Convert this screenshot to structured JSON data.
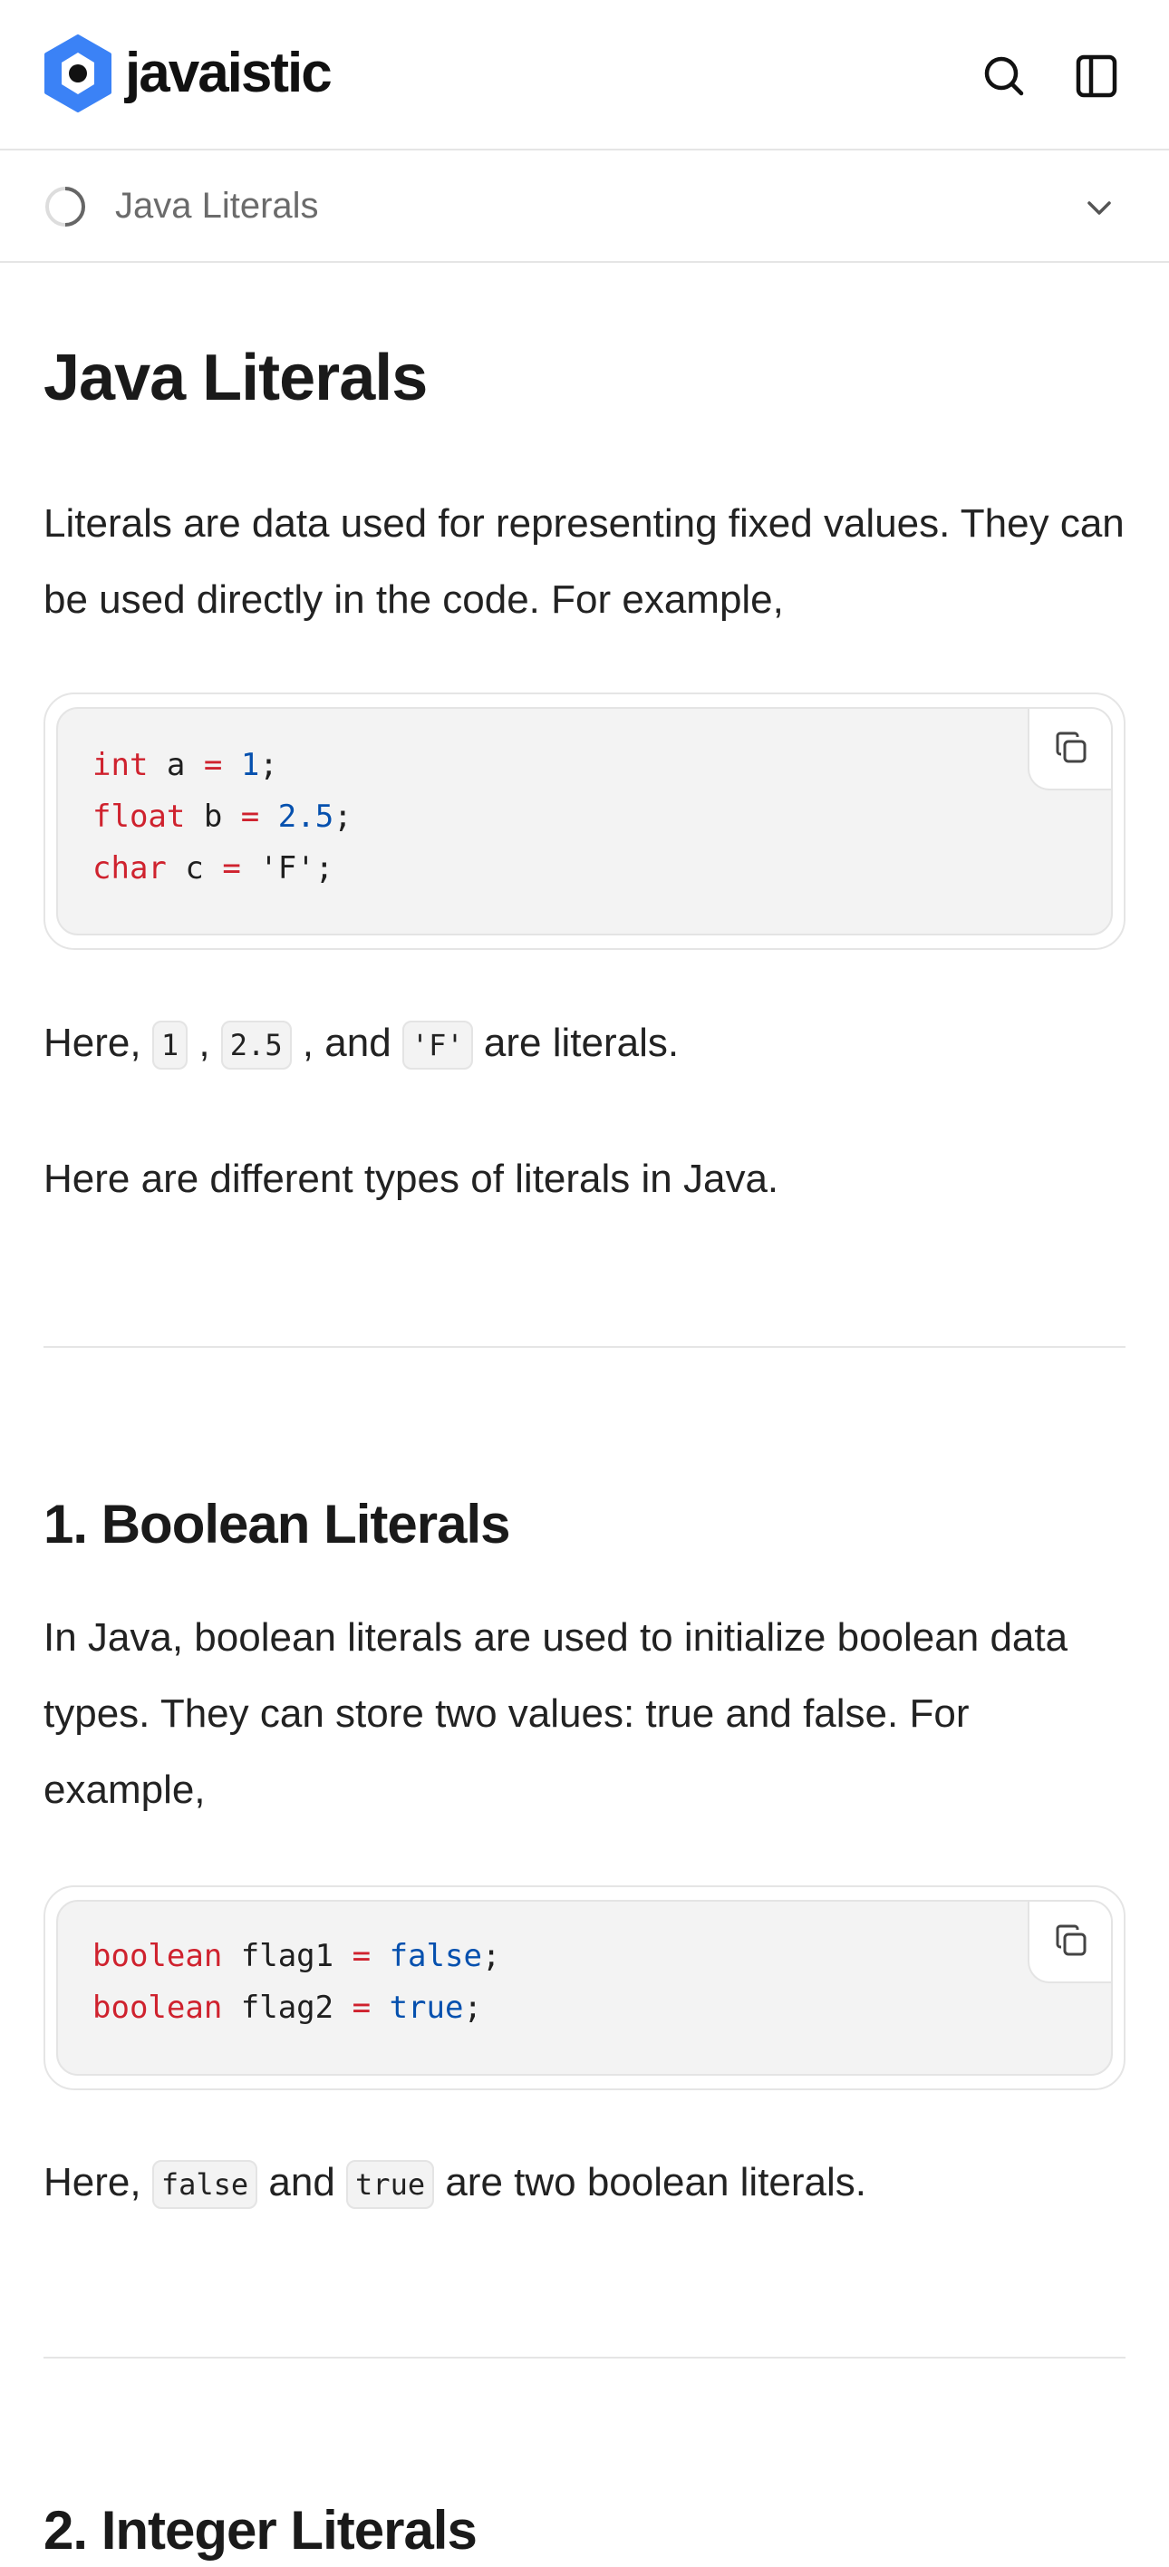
{
  "header": {
    "brand": "javaistic",
    "brand_color": "#3b82f6",
    "icons": [
      "search-icon",
      "sidebar-toggle-icon"
    ]
  },
  "breadcrumb": {
    "label": "Java Literals"
  },
  "article": {
    "title": "Java Literals",
    "intro": "Literals are data used for representing fixed values. They can be used directly in the code. For example,",
    "code1": [
      [
        {
          "t": "int",
          "c": "kw"
        },
        {
          "t": " a "
        },
        {
          "t": "=",
          "c": "kw"
        },
        {
          "t": " "
        },
        {
          "t": "1",
          "c": "num"
        },
        {
          "t": ";"
        }
      ],
      [
        {
          "t": "float",
          "c": "kw"
        },
        {
          "t": " b "
        },
        {
          "t": "=",
          "c": "kw"
        },
        {
          "t": " "
        },
        {
          "t": "2.5",
          "c": "num"
        },
        {
          "t": ";"
        }
      ],
      [
        {
          "t": "char",
          "c": "kw"
        },
        {
          "t": " c "
        },
        {
          "t": "=",
          "c": "kw"
        },
        {
          "t": " 'F';"
        }
      ]
    ],
    "here1": {
      "pre": "Here, ",
      "c1": "1",
      "s1": " , ",
      "c2": "2.5",
      "s2": " , and ",
      "c3": "'F'",
      "post": " are literals."
    },
    "types": "Here are different types of literals in Java.",
    "section1_title": "1. Boolean Literals",
    "section1_text": "In Java, boolean literals are used to initialize boolean data types. They can store two values: true and false. For example,",
    "code2": [
      [
        {
          "t": "boolean",
          "c": "kw"
        },
        {
          "t": " flag1 "
        },
        {
          "t": "=",
          "c": "kw"
        },
        {
          "t": " "
        },
        {
          "t": "false",
          "c": "num"
        },
        {
          "t": ";"
        }
      ],
      [
        {
          "t": "boolean",
          "c": "kw"
        },
        {
          "t": " flag2 "
        },
        {
          "t": "=",
          "c": "kw"
        },
        {
          "t": " "
        },
        {
          "t": "true",
          "c": "num"
        },
        {
          "t": ";"
        }
      ]
    ],
    "here2": {
      "pre": "Here, ",
      "c1": "false",
      "s1": " and ",
      "c2": "true",
      "post": " are two boolean literals."
    },
    "section2_title": "2. Integer Literals"
  },
  "colors": {
    "keyword": "#cf222e",
    "literal": "#0550ae"
  }
}
